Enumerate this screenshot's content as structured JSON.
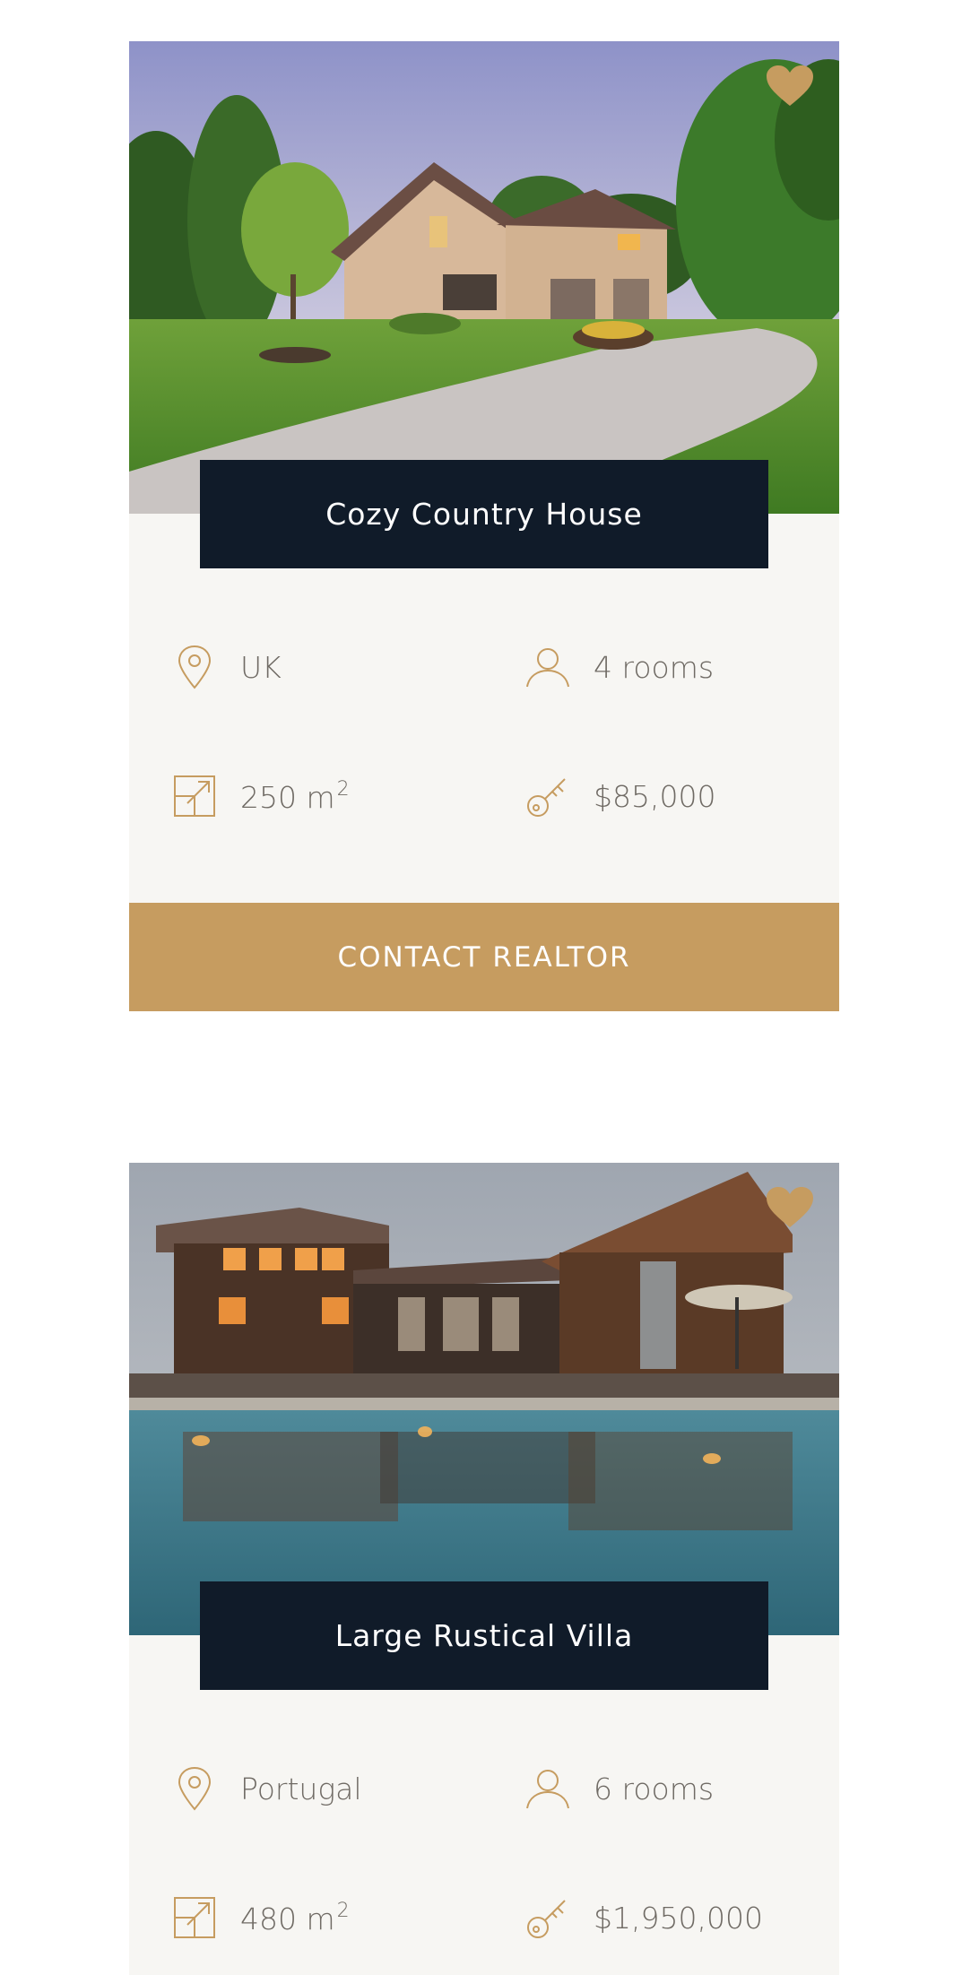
{
  "colors": {
    "accent": "#c69c60",
    "title_bg": "#101b29",
    "card_bg": "#f7f6f3",
    "text": "#6f6a64"
  },
  "listings": [
    {
      "title": "Cozy Country House",
      "location": "UK",
      "rooms": "4 rooms",
      "area": "250 m",
      "area_unit_sup": "2",
      "price": "$85,000",
      "contact_label": "CONTACT REALTOR",
      "image": "house-photo"
    },
    {
      "title": "Large Rustical Villa",
      "location": "Portugal",
      "rooms": "6 rooms",
      "area": "480 m",
      "area_unit_sup": "2",
      "price": "$1,950,000",
      "image": "villa-photo"
    }
  ],
  "icons": {
    "favorite": "heart-icon",
    "location": "map-pin-icon",
    "rooms": "person-icon",
    "area": "area-expand-icon",
    "price": "key-icon"
  }
}
